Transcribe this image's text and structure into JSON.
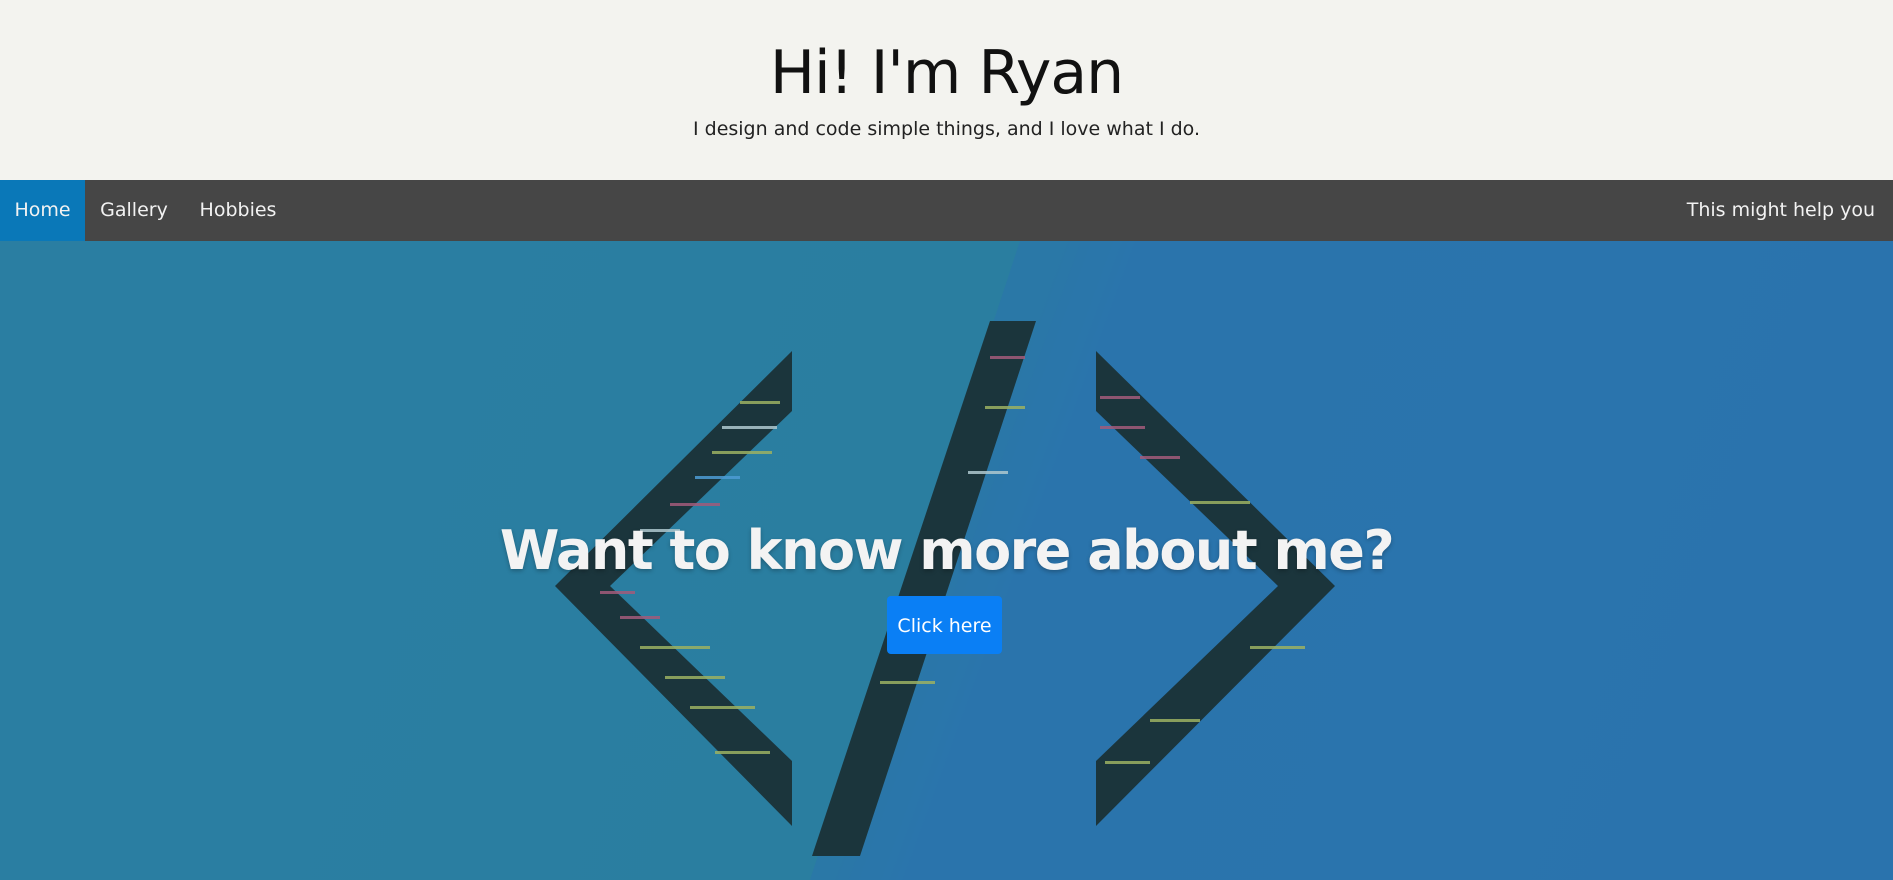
{
  "header": {
    "title": "Hi! I'm Ryan",
    "tagline": "I design and code simple things, and I love what I do."
  },
  "nav": {
    "items": [
      {
        "label": "Home",
        "active": true
      },
      {
        "label": "Gallery"
      },
      {
        "label": "Hobbies"
      }
    ],
    "right_link": "This might help you"
  },
  "hero": {
    "heading": "Want to know more about me?",
    "button_label": "Click here"
  },
  "colors": {
    "header_bg": "#f3f3ef",
    "nav_bg": "#464646",
    "nav_active": "#0a78b8",
    "hero_bg": "#2a7aa3",
    "button": "#0a7ff5"
  }
}
